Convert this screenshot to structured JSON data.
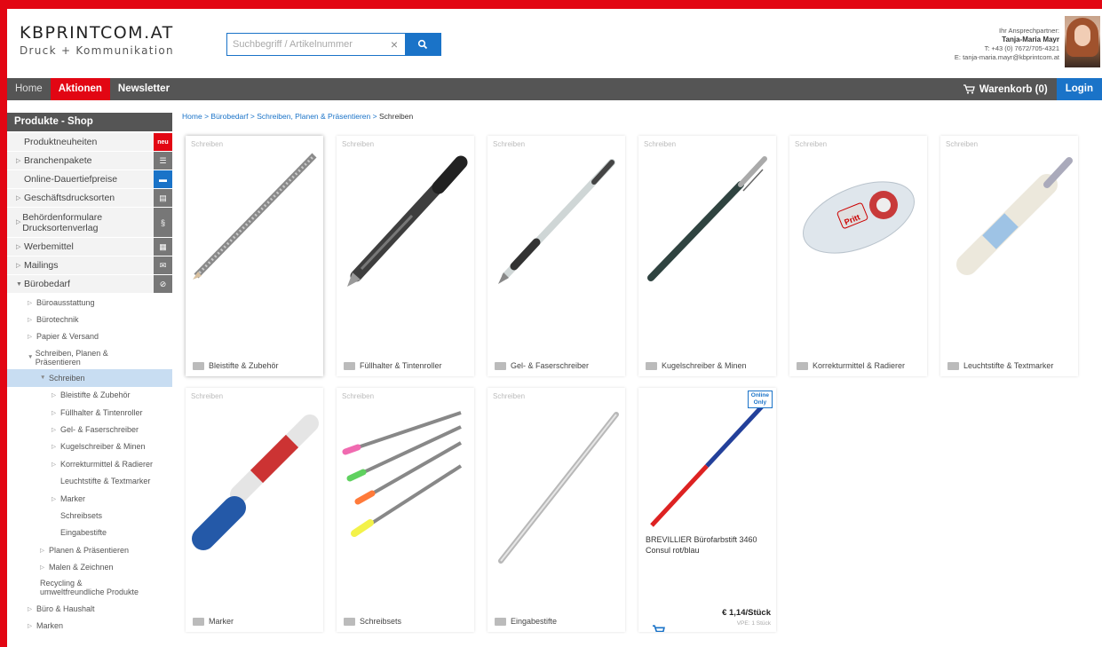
{
  "header": {
    "logo_top": "KBPRINTCOM.AT",
    "logo_bottom": "Druck + Kommunikation",
    "search_placeholder": "Suchbegriff / Artikelnummer",
    "contact_label": "Ihr Ansprechpartner:",
    "contact_name": "Tanja-Maria Mayr",
    "contact_phone": "T: +43 (0) 7672/705-4321",
    "contact_email": "E: tanja-maria.mayr@kbprintcom.at"
  },
  "nav": {
    "home": "Home",
    "aktionen": "Aktionen",
    "newsletter": "Newsletter",
    "cart": "Warenkorb (0)",
    "login": "Login"
  },
  "sidebar": {
    "title": "Produkte - Shop",
    "categories": [
      {
        "label": "Produktneuheiten",
        "icon": "neu"
      },
      {
        "label": "Branchenpakete",
        "icon": "list-icon"
      },
      {
        "label": "Online-Dauertiefpreise",
        "icon": "chat-icon"
      },
      {
        "label": "Geschäftsdrucksorten",
        "icon": "document-icon"
      },
      {
        "label": "Behördenformulare Drucksortenverlag",
        "icon": "paragraph-icon"
      },
      {
        "label": "Werbemittel",
        "icon": "calendar-icon"
      },
      {
        "label": "Mailings",
        "icon": "mail-icon"
      },
      {
        "label": "Bürobedarf",
        "icon": "paperclip-icon"
      }
    ],
    "sub": [
      "Büroausstattung",
      "Bürotechnik",
      "Papier & Versand",
      "Schreiben, Planen & Präsentieren",
      "Schreiben",
      "Bleistifte & Zubehör",
      "Füllhalter & Tintenroller",
      "Gel- & Faserschreiber",
      "Kugelschreiber & Minen",
      "Korrekturmittel & Radierer",
      "Leuchtstifte & Textmarker",
      "Marker",
      "Schreibsets",
      "Eingabestifte",
      "Planen & Präsentieren",
      "Malen & Zeichnen",
      "Recycling & umweltfreundliche Produkte",
      "Büro & Haushalt",
      "Marken"
    ]
  },
  "breadcrumb": {
    "home": "Home",
    "level1": "Bürobedarf",
    "level2": "Schreiben, Planen & Präsentieren",
    "current": "Schreiben",
    "sep": ">"
  },
  "products": {
    "tag": "Schreiben",
    "items": [
      "Bleistifte & Zubehör",
      "Füllhalter & Tintenroller",
      "Gel- & Faserschreiber",
      "Kugelschreiber & Minen",
      "Korrekturmittel & Radierer",
      "Leuchtstifte & Textmarker",
      "Marker",
      "Schreibsets",
      "Eingabestifte"
    ],
    "featured": {
      "badge_line1": "Online",
      "badge_line2": "Only",
      "name": "BREVILLIER Bürofarbstift 3460 Consul rot/blau",
      "price": "€ 1,14/Stück",
      "vpe": "VPE: 1 Stück"
    }
  },
  "colors": {
    "brand_red": "#e20613",
    "nav_gray": "#555555",
    "accent_blue": "#1a73c8"
  }
}
